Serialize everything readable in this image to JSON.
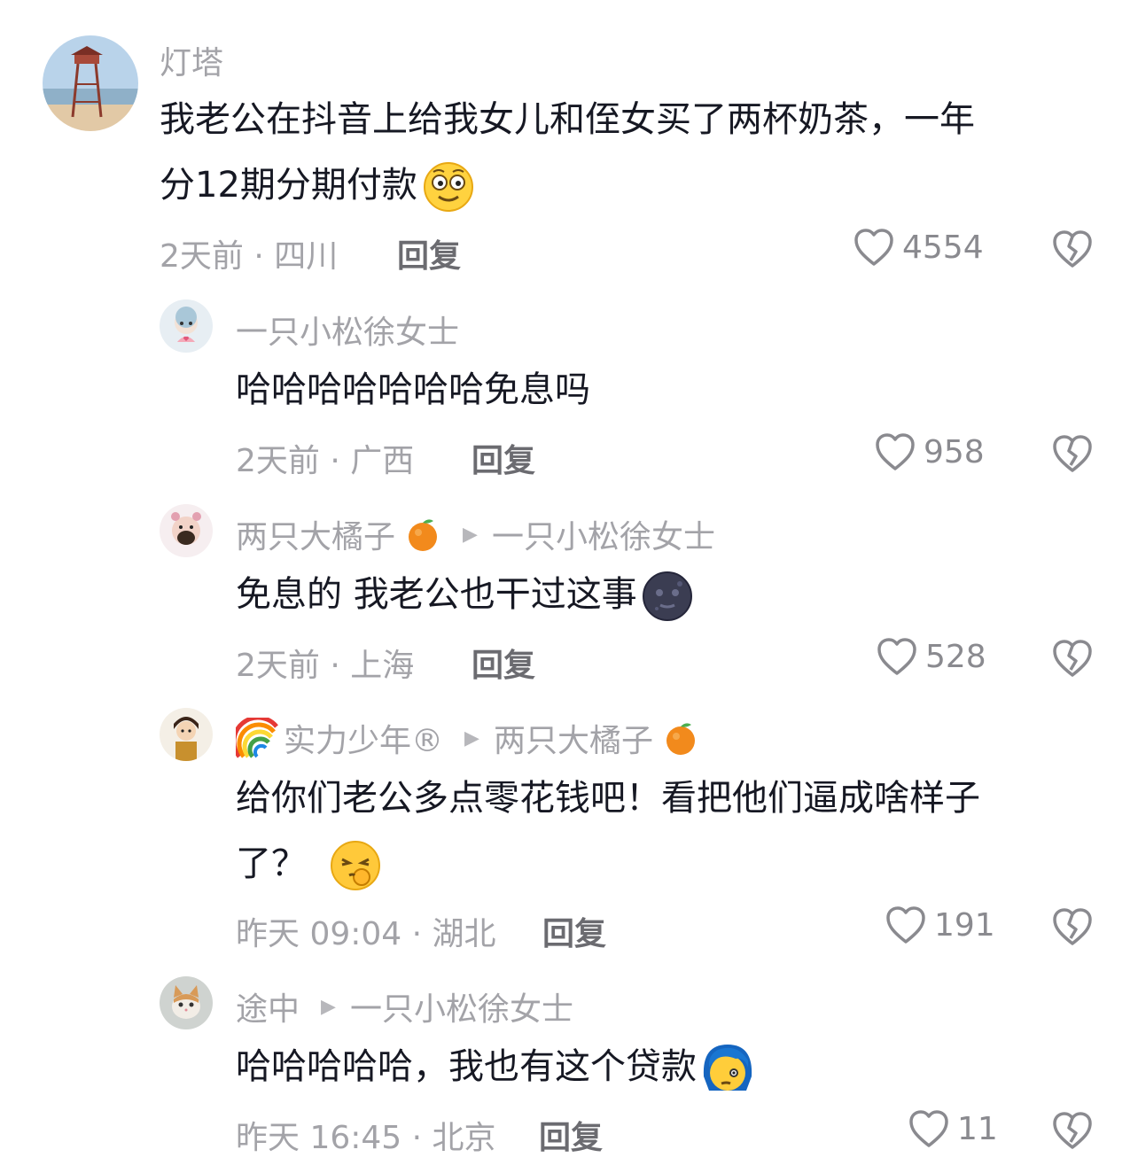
{
  "comments": [
    {
      "username": "灯塔",
      "text_line1": "我老公在抖音上给我女儿和侄女买了两杯奶茶，一年",
      "text_line2": "分12期分期付款",
      "time_location": "2天前 · 四川",
      "reply_label": "回复",
      "likes": "4554"
    },
    {
      "username": "一只小松徐女士",
      "text": "哈哈哈哈哈哈哈免息吗",
      "time_location": "2天前 · 广西",
      "reply_label": "回复",
      "likes": "958"
    },
    {
      "username": "两只大橘子",
      "reply_to": "一只小松徐女士",
      "text": "免息的 我老公也干过这事",
      "time_location": "2天前 · 上海",
      "reply_label": "回复",
      "likes": "528"
    },
    {
      "username": "实力少年®",
      "reply_to": "两只大橘子",
      "text_line1": "给你们老公多点零花钱吧！看把他们逼成啥样子",
      "text_line2": "了？",
      "time_location": "昨天 09:04 · 湖北",
      "reply_label": "回复",
      "likes": "191"
    },
    {
      "username": "途中",
      "reply_to": "一只小松徐女士",
      "text": "哈哈哈哈哈，我也有这个贷款",
      "time_location": "昨天 16:45 · 北京",
      "reply_label": "回复",
      "likes": "11"
    }
  ],
  "icons": {
    "like": "heart-outline-icon",
    "dislike": "broken-heart-icon",
    "reply_arrow": "triangle-right-icon"
  },
  "colors": {
    "text": "#161823",
    "secondary": "#a3a3a8",
    "reply": "#6b6b70"
  }
}
